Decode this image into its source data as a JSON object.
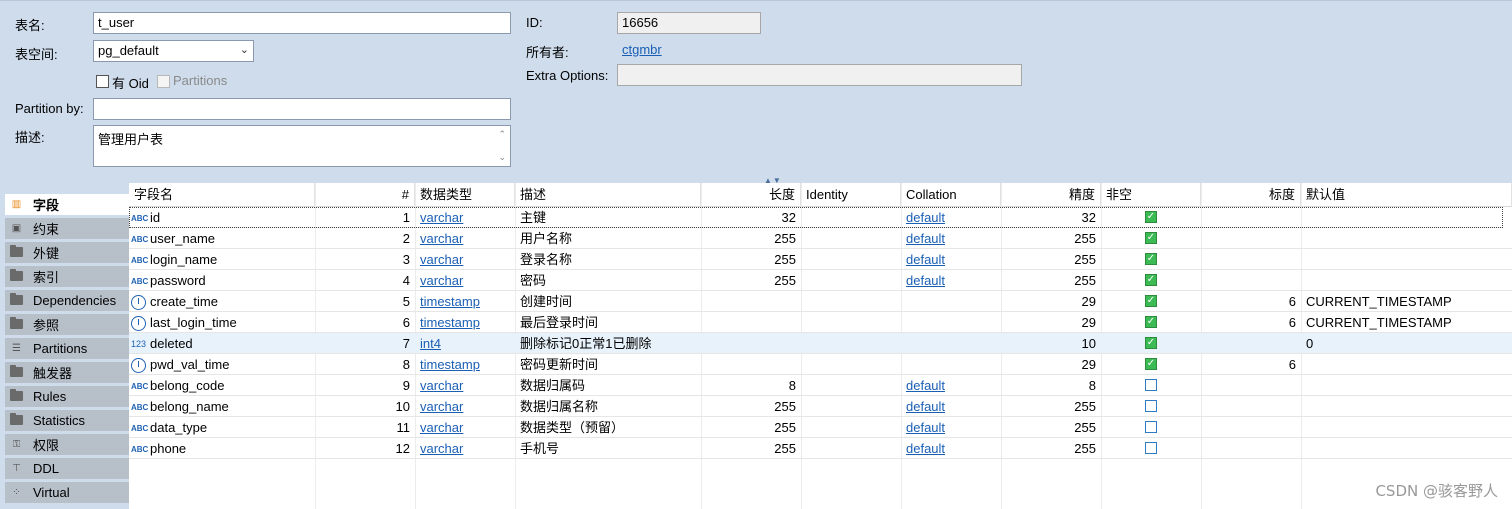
{
  "props": {
    "table_name_label": "表名:",
    "table_name_value": "t_user",
    "tablespace_label": "表空间:",
    "tablespace_value": "pg_default",
    "has_oid_label": "有 Oid",
    "partitions_label": "Partitions",
    "partition_by_label": "Partition by:",
    "partition_by_value": "",
    "desc_label": "描述:",
    "desc_value": "管理用户表",
    "id_label": "ID:",
    "id_value": "16656",
    "owner_label": "所有者:",
    "owner_value": "ctgmbr",
    "extra_options_label": "Extra Options:",
    "extra_options_value": ""
  },
  "nav": {
    "items": [
      {
        "label": "字段",
        "icon": "columns-icon",
        "active": true
      },
      {
        "label": "约束",
        "icon": "constraint-icon"
      },
      {
        "label": "外键",
        "icon": "folder-icon"
      },
      {
        "label": "索引",
        "icon": "folder-icon"
      },
      {
        "label": "Dependencies",
        "icon": "folder-icon"
      },
      {
        "label": "参照",
        "icon": "folder-icon"
      },
      {
        "label": "Partitions",
        "icon": "list-icon"
      },
      {
        "label": "触发器",
        "icon": "folder-icon"
      },
      {
        "label": "Rules",
        "icon": "folder-icon"
      },
      {
        "label": "Statistics",
        "icon": "folder-icon"
      },
      {
        "label": "权限",
        "icon": "key-icon"
      },
      {
        "label": "DDL",
        "icon": "ddl-icon"
      },
      {
        "label": "Virtual",
        "icon": "virtual-icon"
      }
    ]
  },
  "grid": {
    "headers": [
      "字段名",
      "#",
      "数据类型",
      "描述",
      "长度",
      "Identity",
      "Collation",
      "精度",
      "非空",
      "标度",
      "默认值"
    ],
    "rows": [
      {
        "type_icon": "abc",
        "name": "id",
        "num": "1",
        "dtype": "varchar",
        "desc": "主键",
        "len": "32",
        "identity": "",
        "collation": "default",
        "precision": "32",
        "notnull": true,
        "scale": "",
        "default": ""
      },
      {
        "type_icon": "abc",
        "name": "user_name",
        "num": "2",
        "dtype": "varchar",
        "desc": "用户名称",
        "len": "255",
        "identity": "",
        "collation": "default",
        "precision": "255",
        "notnull": true,
        "scale": "",
        "default": ""
      },
      {
        "type_icon": "abc",
        "name": "login_name",
        "num": "3",
        "dtype": "varchar",
        "desc": "登录名称",
        "len": "255",
        "identity": "",
        "collation": "default",
        "precision": "255",
        "notnull": true,
        "scale": "",
        "default": ""
      },
      {
        "type_icon": "abc",
        "name": "password",
        "num": "4",
        "dtype": "varchar",
        "desc": "密码",
        "len": "255",
        "identity": "",
        "collation": "default",
        "precision": "255",
        "notnull": true,
        "scale": "",
        "default": ""
      },
      {
        "type_icon": "clock",
        "name": "create_time",
        "num": "5",
        "dtype": "timestamp",
        "desc": "创建时间",
        "len": "",
        "identity": "",
        "collation": "",
        "precision": "29",
        "notnull": true,
        "scale": "6",
        "default": "CURRENT_TIMESTAMP"
      },
      {
        "type_icon": "clock",
        "name": "last_login_time",
        "num": "6",
        "dtype": "timestamp",
        "desc": "最后登录时间",
        "len": "",
        "identity": "",
        "collation": "",
        "precision": "29",
        "notnull": true,
        "scale": "6",
        "default": "CURRENT_TIMESTAMP"
      },
      {
        "type_icon": "123",
        "name": "deleted",
        "num": "7",
        "dtype": "int4",
        "desc": "删除标记0正常1已删除",
        "len": "",
        "identity": "",
        "collation": "",
        "precision": "10",
        "notnull": true,
        "scale": "",
        "default": "0"
      },
      {
        "type_icon": "clock",
        "name": "pwd_val_time",
        "num": "8",
        "dtype": "timestamp",
        "desc": "密码更新时间",
        "len": "",
        "identity": "",
        "collation": "",
        "precision": "29",
        "notnull": true,
        "scale": "6",
        "default": ""
      },
      {
        "type_icon": "abc",
        "name": "belong_code",
        "num": "9",
        "dtype": "varchar",
        "desc": "数据归属码",
        "len": "8",
        "identity": "",
        "collation": "default",
        "precision": "8",
        "notnull": false,
        "scale": "",
        "default": ""
      },
      {
        "type_icon": "abc",
        "name": "belong_name",
        "num": "10",
        "dtype": "varchar",
        "desc": "数据归属名称",
        "len": "255",
        "identity": "",
        "collation": "default",
        "precision": "255",
        "notnull": false,
        "scale": "",
        "default": ""
      },
      {
        "type_icon": "abc",
        "name": "data_type",
        "num": "11",
        "dtype": "varchar",
        "desc": "数据类型（预留）",
        "len": "255",
        "identity": "",
        "collation": "default",
        "precision": "255",
        "notnull": false,
        "scale": "",
        "default": ""
      },
      {
        "type_icon": "abc",
        "name": "phone",
        "num": "12",
        "dtype": "varchar",
        "desc": "手机号",
        "len": "255",
        "identity": "",
        "collation": "default",
        "precision": "255",
        "notnull": false,
        "scale": "",
        "default": ""
      }
    ]
  },
  "watermark": "CSDN @骇客野人"
}
